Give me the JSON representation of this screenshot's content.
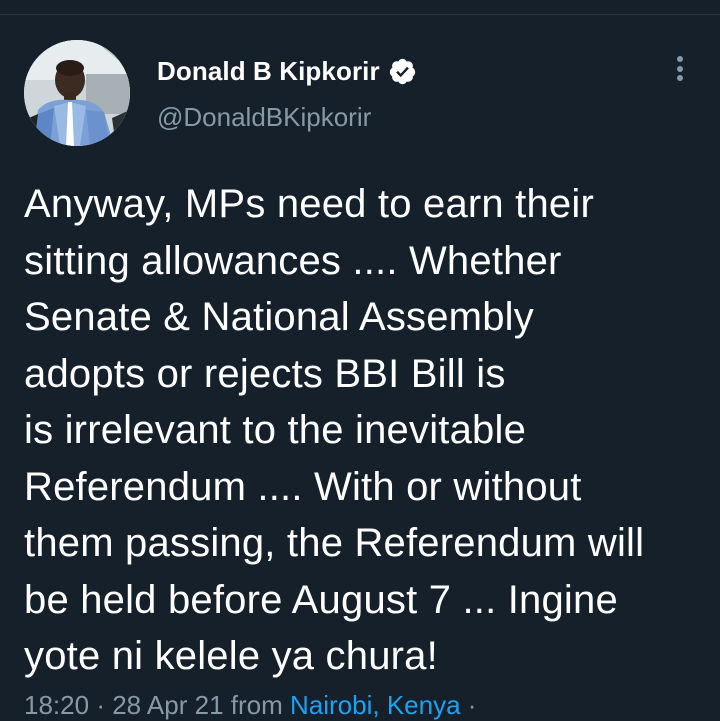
{
  "tweet": {
    "author": {
      "name": "Donald B Kipkorir",
      "handle": "@DonaldBKipkorir",
      "verified": true,
      "avatar_icon": "profile-photo"
    },
    "text_lines": [
      "Anyway, MPs need to earn their",
      "sitting allowances .... Whether",
      "Senate & National Assembly",
      "adopts or rejects BBI Bill is",
      "is irrelevant to the inevitable",
      "Referendum .... With or without",
      "them passing, the Referendum will",
      "be held before August 7 ... Ingine",
      "yote ni kelele ya chura!"
    ],
    "meta": {
      "time": "18:20",
      "separator": "·",
      "date": "28 Apr 21",
      "from_label": "from",
      "location": "Nairobi, Kenya"
    }
  },
  "colors": {
    "background": "#15202b",
    "text": "#ffffff",
    "secondary_text": "#8899a6",
    "link": "#1da1f2",
    "verified_badge": "#ffffff"
  },
  "icons": {
    "verified": "verified-badge-icon",
    "more": "more-vertical-icon"
  }
}
